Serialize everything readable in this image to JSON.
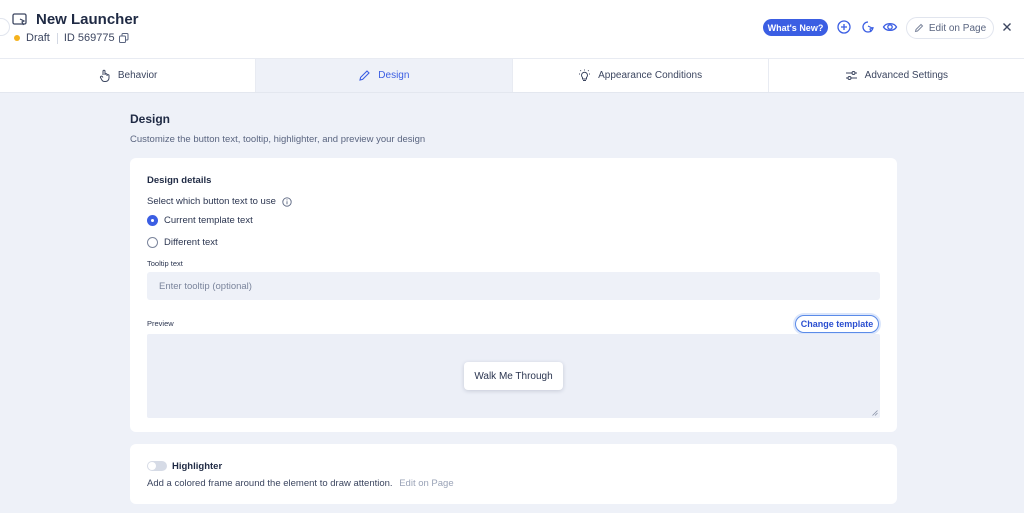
{
  "header": {
    "title": "New Launcher",
    "status": "Draft",
    "id_text": "ID 569775",
    "whats_new_label": "What's New?",
    "edit_on_page_label": "Edit on Page"
  },
  "tabs": [
    {
      "label": "Behavior",
      "icon": "hand-pointer-icon"
    },
    {
      "label": "Design",
      "icon": "pencil-icon"
    },
    {
      "label": "Appearance Conditions",
      "icon": "lightbulb-icon"
    },
    {
      "label": "Advanced Settings",
      "icon": "sliders-icon"
    }
  ],
  "content": {
    "title": "Design",
    "subtitle": "Customize the button text, tooltip, highlighter, and preview your design"
  },
  "design_details": {
    "title": "Design details",
    "select_label": "Select which button text to use",
    "option_current": "Current template text",
    "option_different": "Different text",
    "tooltip_label": "Tooltip text",
    "tooltip_placeholder": "Enter tooltip (optional)",
    "preview_label": "Preview",
    "change_template_label": "Change template",
    "preview_button_label": "Walk Me Through"
  },
  "highlighter": {
    "label": "Highlighter",
    "description": "Add a colored frame around the element to draw attention.",
    "edit_link": "Edit on Page"
  },
  "colors": {
    "accent": "#3b5ee3",
    "draft_dot": "#f5b21d",
    "background": "#eef1f8"
  }
}
